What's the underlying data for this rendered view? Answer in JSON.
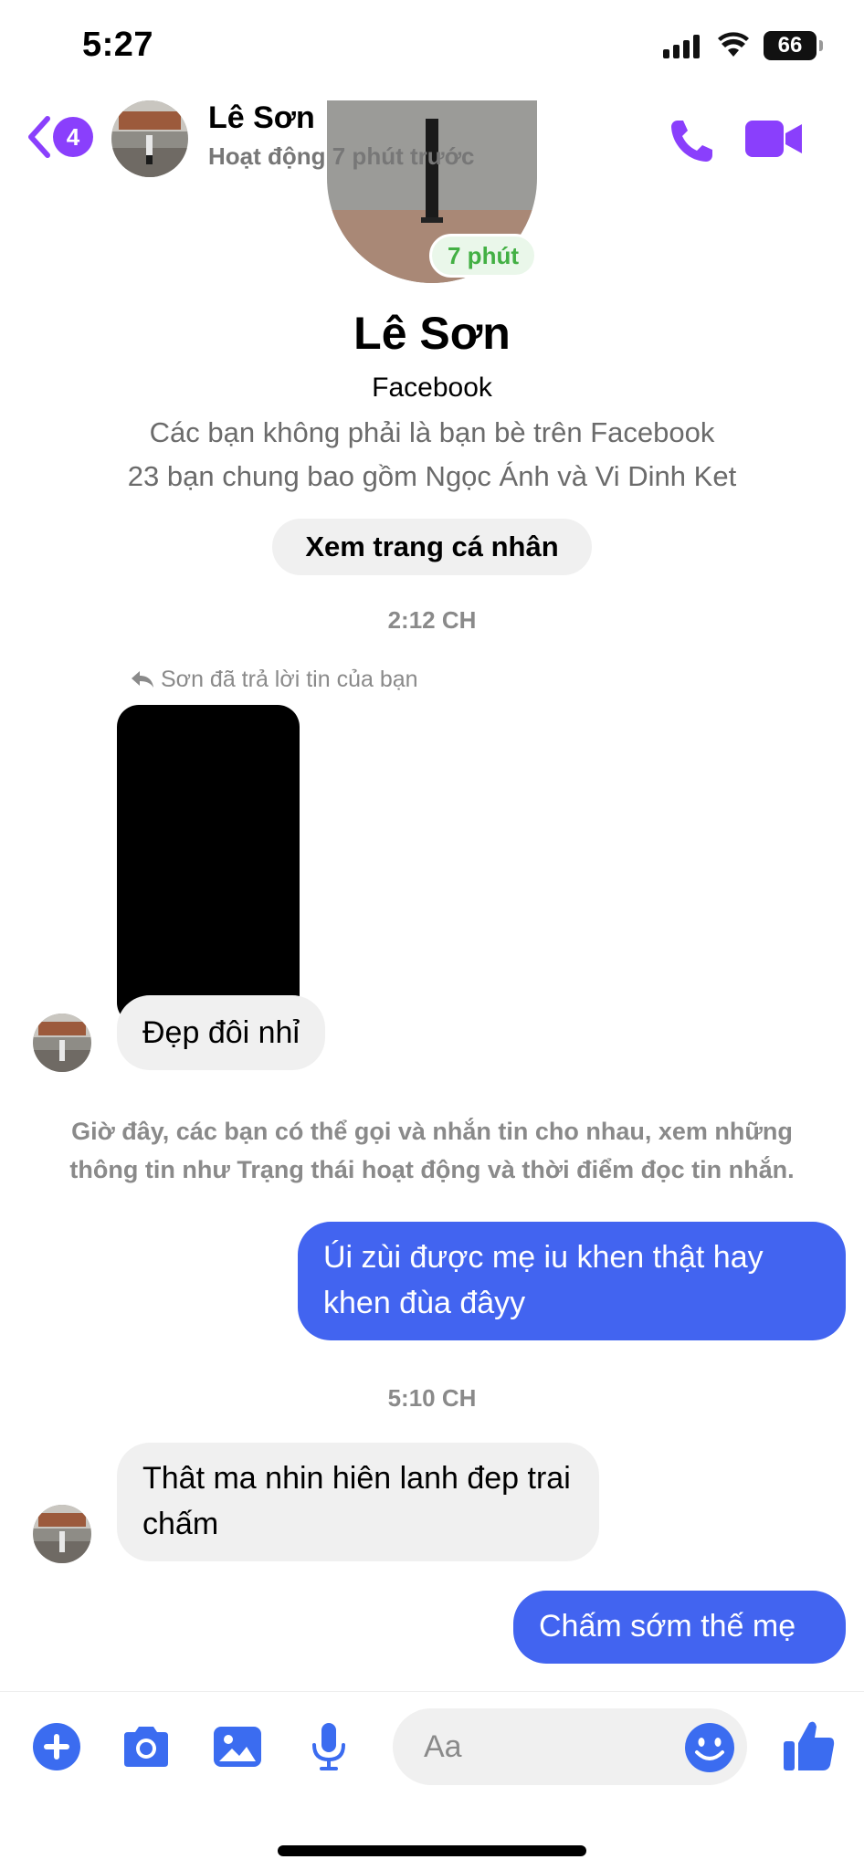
{
  "status_bar": {
    "time": "5:27",
    "battery": "66"
  },
  "header": {
    "back_badge": "4",
    "name": "Lê Sơn",
    "active_status": "Hoạt động 7 phút trước"
  },
  "profile": {
    "active_chip": "7 phút",
    "name": "Lê Sơn",
    "platform": "Facebook",
    "friend_status": "Các bạn không phải là bạn bè trên Facebook",
    "mutual_friends": "23 bạn chung bao gồm Ngọc Ánh và Vi Dinh Ket",
    "view_profile_label": "Xem trang cá nhân"
  },
  "conversation": {
    "timestamp_1": "2:12 CH",
    "reply_note": "Sơn đã trả lời tin của bạn",
    "message_1": "Đẹp đôi nhỉ",
    "system_note": "Giờ đây, các bạn có thể gọi và nhắn tin cho nhau, xem những thông tin như Trạng thái hoạt động và thời điểm đọc tin nhắn.",
    "message_2": "Úi zùi được mẹ iu khen thật hay khen đùa đâyy",
    "timestamp_2": "5:10 CH",
    "message_3": "Thât ma nhin hiên lanh đep trai chấm",
    "message_4": "Chấm sớm thế mẹ"
  },
  "composer": {
    "placeholder": "Aa"
  },
  "colors": {
    "accent_purple": "#8a3ffc",
    "outgoing_bubble": "#4264f0",
    "composer_icons": "#3b6cf0",
    "active_green": "#43b044"
  },
  "icons": [
    "back-chevron-icon",
    "phone-icon",
    "video-camera-icon",
    "reply-arrow-icon",
    "plus-circle-icon",
    "camera-icon",
    "gallery-icon",
    "microphone-icon",
    "emoji-icon",
    "thumbs-up-icon"
  ]
}
